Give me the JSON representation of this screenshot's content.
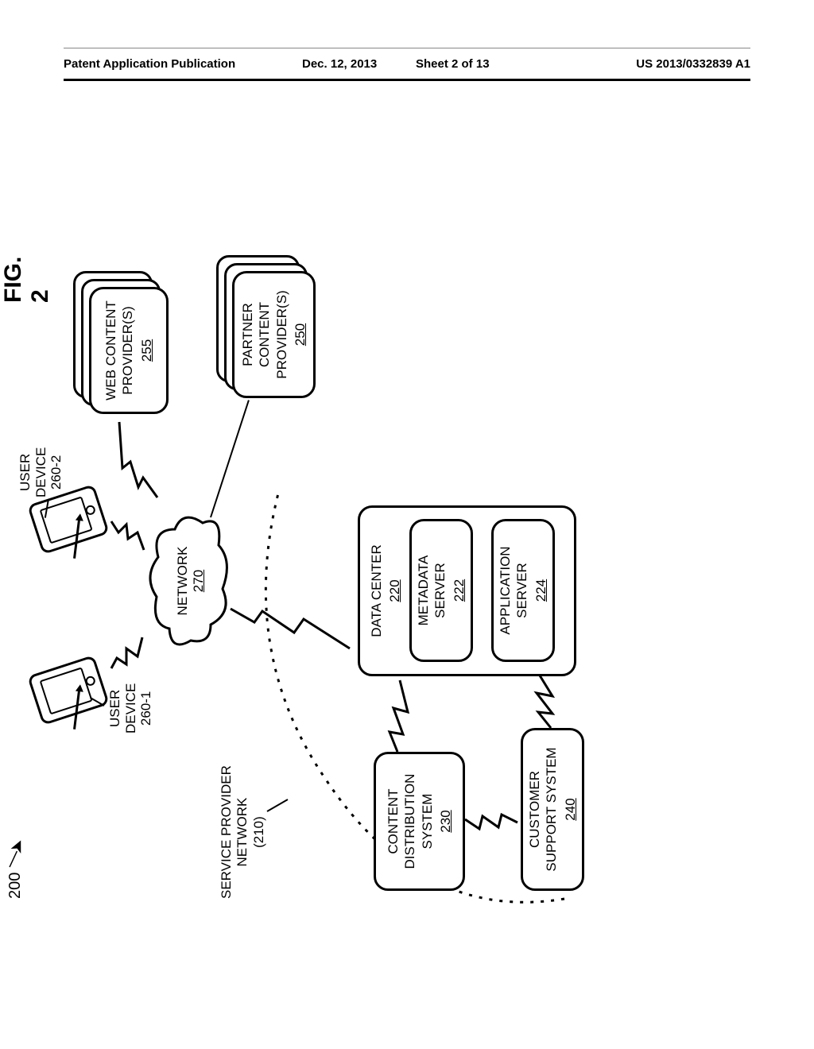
{
  "header": {
    "pub_type": "Patent Application Publication",
    "date": "Dec. 12, 2013",
    "sheet": "Sheet 2 of 13",
    "pubno": "US 2013/0332839 A1"
  },
  "figure": {
    "label": "FIG. 2",
    "ref": "200",
    "service_provider_network": {
      "label": "SERVICE PROVIDER\nNETWORK\n(210)"
    },
    "user_device_1": {
      "label": "USER\nDEVICE",
      "ref": "260-1"
    },
    "user_device_2": {
      "label": "USER\nDEVICE",
      "ref": "260-2"
    },
    "network_cloud": {
      "label": "NETWORK",
      "ref": "270"
    },
    "web_content": {
      "label": "WEB CONTENT\nPROVIDER(S)",
      "ref": "255"
    },
    "partner_content": {
      "label": "PARTNER\nCONTENT\nPROVIDER(S)",
      "ref": "250"
    },
    "content_dist": {
      "label": "CONTENT\nDISTRIBUTION\nSYSTEM",
      "ref": "230"
    },
    "customer_support": {
      "label": "CUSTOMER\nSUPPORT SYSTEM",
      "ref": "240"
    },
    "data_center": {
      "label": "DATA CENTER",
      "ref": "220"
    },
    "metadata_server": {
      "label": "METADATA\nSERVER",
      "ref": "222"
    },
    "app_server": {
      "label": "APPLICATION\nSERVER",
      "ref": "224"
    }
  }
}
